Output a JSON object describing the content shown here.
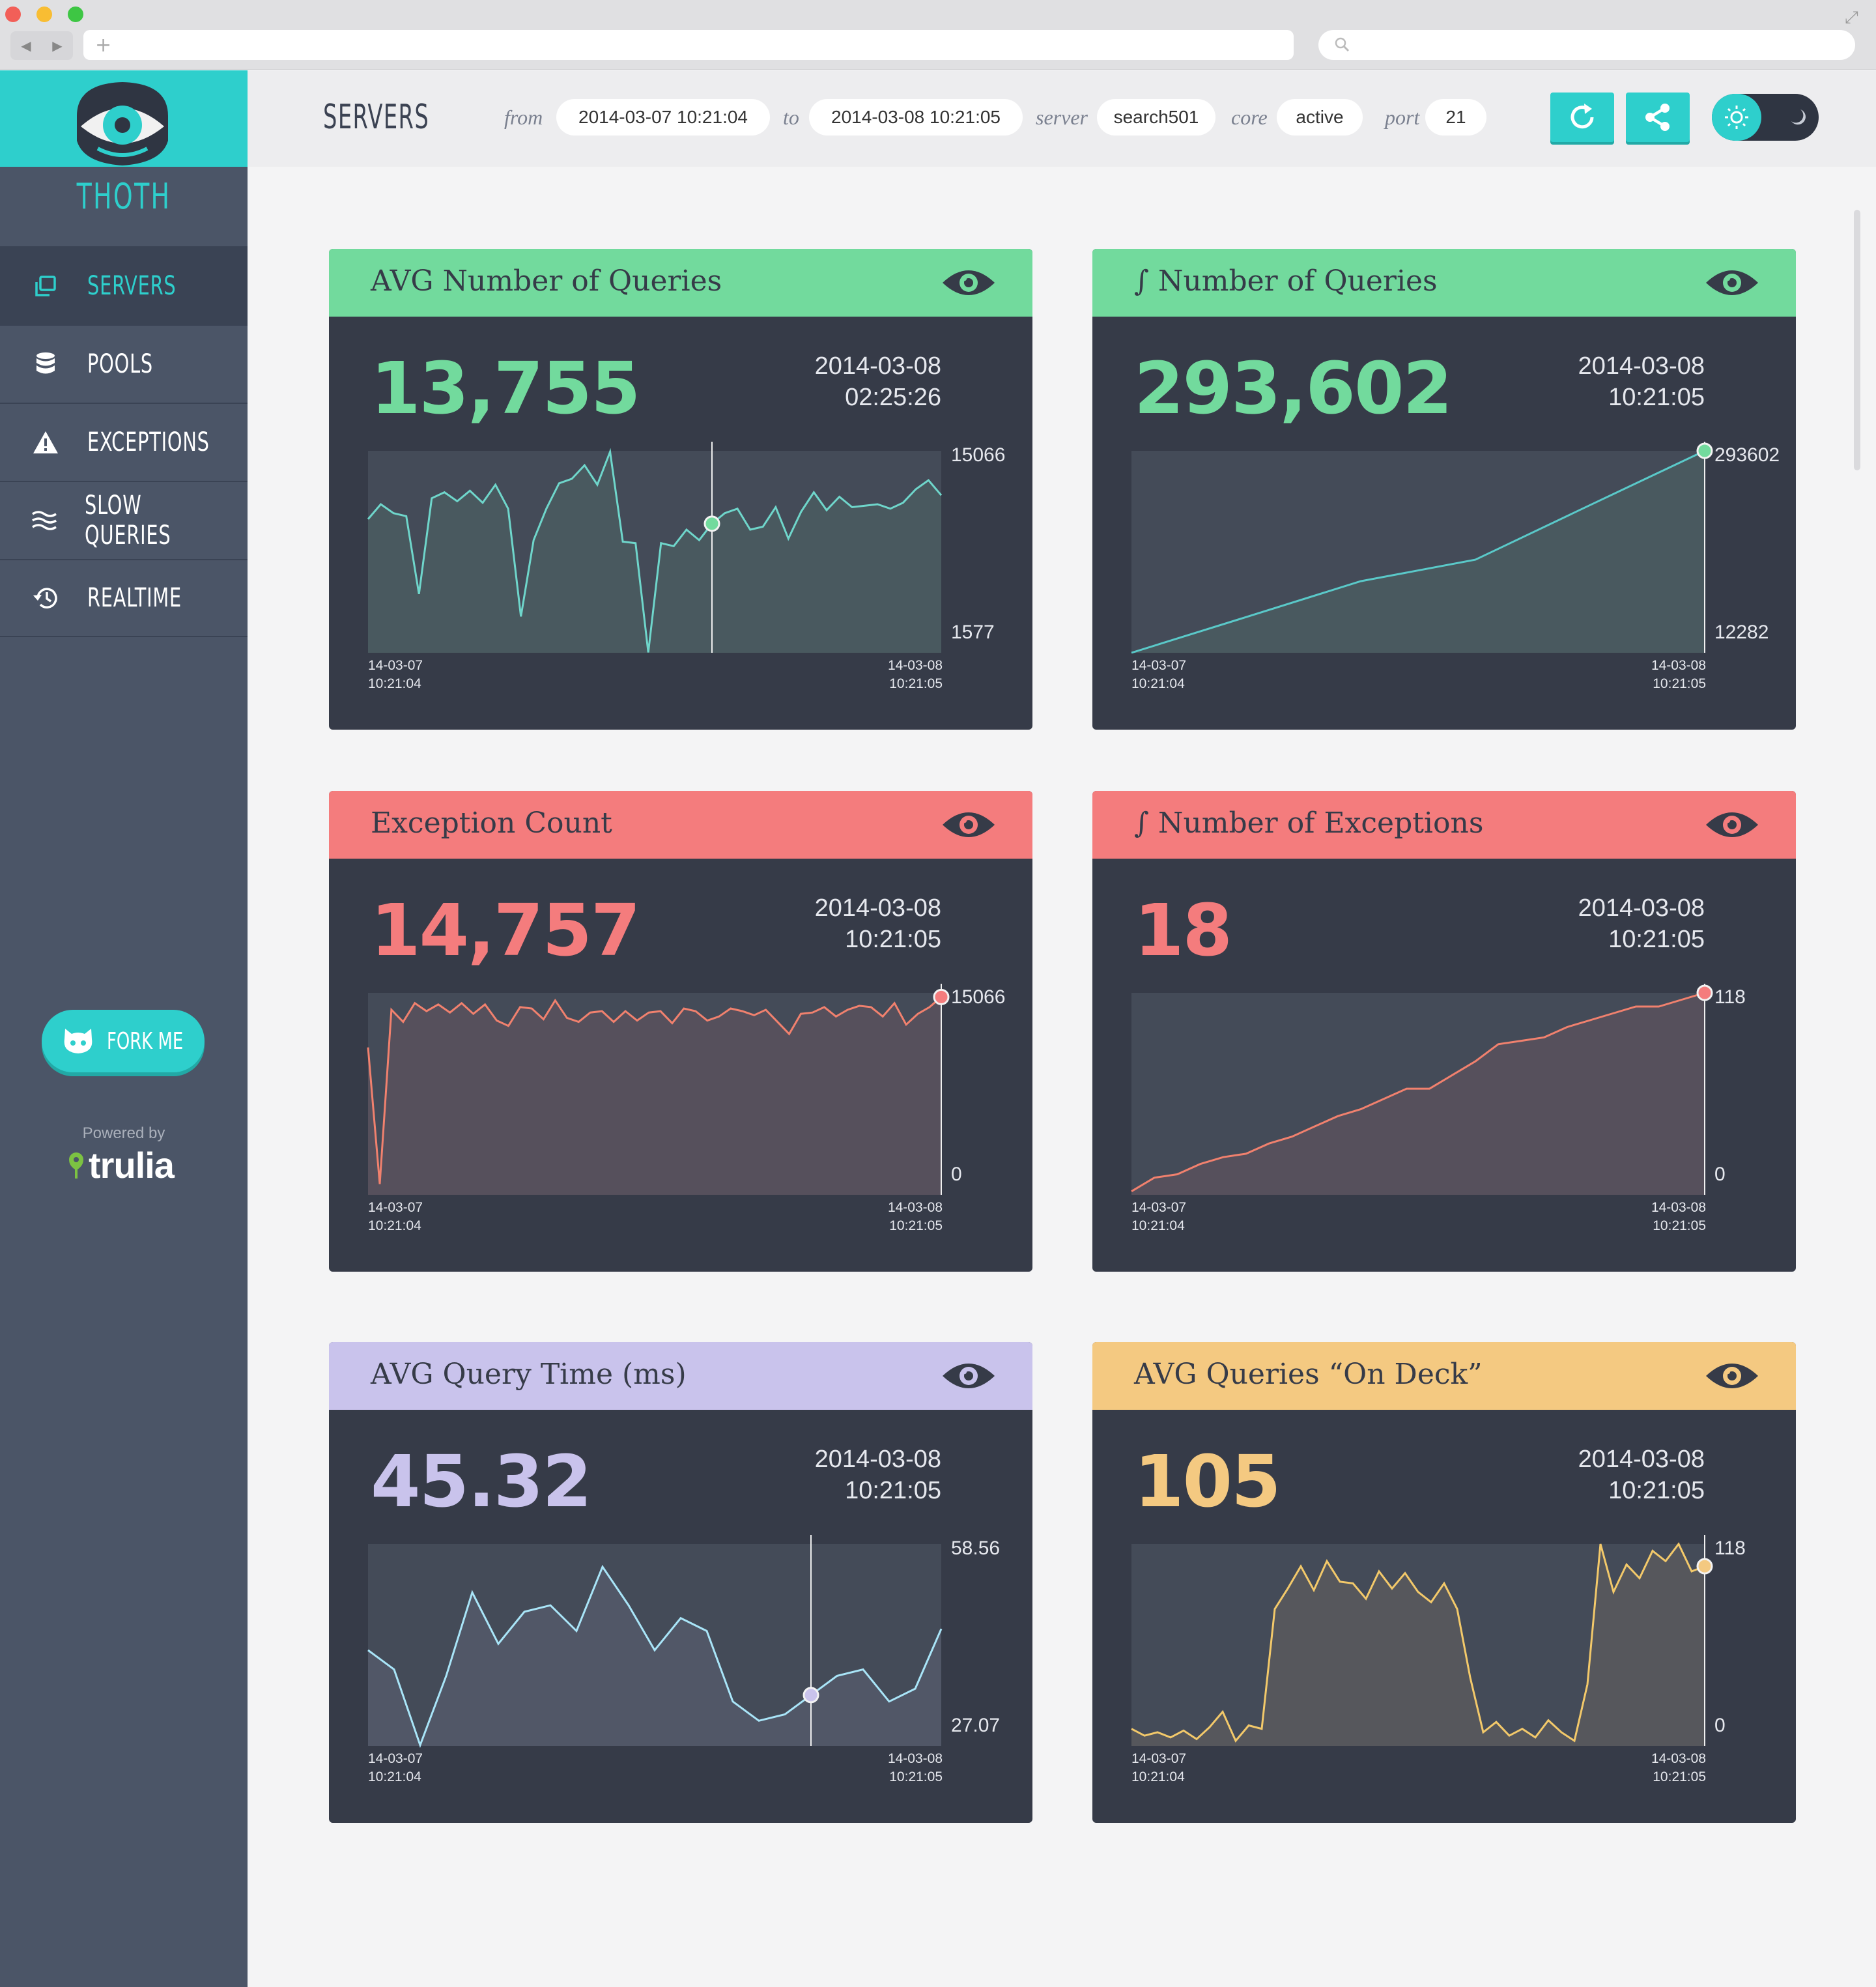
{
  "browser": {
    "new_tab": "+",
    "expand_icon": "expand-icon",
    "search_icon": "search-icon"
  },
  "sidebar": {
    "brand": "THOTH",
    "nav": [
      {
        "label": "SERVERS",
        "icon": "servers-icon",
        "active": true
      },
      {
        "label": "POOLS",
        "icon": "database-icon",
        "active": false
      },
      {
        "label": "EXCEPTIONS",
        "icon": "warning-icon",
        "active": false
      },
      {
        "label": "SLOW QUERIES",
        "icon": "waves-icon",
        "active": false
      },
      {
        "label": "REALTIME",
        "icon": "history-icon",
        "active": false
      }
    ],
    "fork_label": "FORK ME",
    "powered_by": "Powered by",
    "trulia": "trulia"
  },
  "topbar": {
    "title": "SERVERS",
    "from_label": "from",
    "from_value": "2014-03-07 10:21:04",
    "to_label": "to",
    "to_value": "2014-03-08 10:21:05",
    "server_label": "server",
    "server_value": "search501",
    "core_label": "core",
    "core_value": "active",
    "port_label": "port",
    "port_value": "21"
  },
  "colors": {
    "accent": "#2ecfcc",
    "green": "#72da9d",
    "red": "#f47c7d",
    "purple": "#c9c3ec",
    "yellow": "#f4c981",
    "card_bg": "#363b48",
    "sidebar": "#4b5567"
  },
  "cards": [
    {
      "title": "AVG Number of Queries",
      "value": "13,755",
      "date": "2014-03-08",
      "time": "02:25:26",
      "max": "15066",
      "min": "1577",
      "x_start_date": "14-03-07",
      "x_start_time": "10:21:04",
      "x_end_date": "14-03-08",
      "x_end_time": "10:21:05"
    },
    {
      "title": "∫ Number of Queries",
      "value": "293,602",
      "date": "2014-03-08",
      "time": "10:21:05",
      "max": "293602",
      "min": "12282",
      "x_start_date": "14-03-07",
      "x_start_time": "10:21:04",
      "x_end_date": "14-03-08",
      "x_end_time": "10:21:05"
    },
    {
      "title": "Exception Count",
      "value": "14,757",
      "date": "2014-03-08",
      "time": "10:21:05",
      "max": "15066",
      "min": "0",
      "x_start_date": "14-03-07",
      "x_start_time": "10:21:04",
      "x_end_date": "14-03-08",
      "x_end_time": "10:21:05"
    },
    {
      "title": "∫ Number of Exceptions",
      "value": "18",
      "date": "2014-03-08",
      "time": "10:21:05",
      "max": "118",
      "min": "0",
      "x_start_date": "14-03-07",
      "x_start_time": "10:21:04",
      "x_end_date": "14-03-08",
      "x_end_time": "10:21:05"
    },
    {
      "title": "AVG Query Time (ms)",
      "value": "45.32",
      "date": "2014-03-08",
      "time": "10:21:05",
      "max": "58.56",
      "min": "27.07",
      "x_start_date": "14-03-07",
      "x_start_time": "10:21:04",
      "x_end_date": "14-03-08",
      "x_end_time": "10:21:05"
    },
    {
      "title": "AVG Queries “On Deck”",
      "value": "105",
      "date": "2014-03-08",
      "time": "10:21:05",
      "max": "118",
      "min": "0",
      "x_start_date": "14-03-07",
      "x_start_time": "10:21:04",
      "x_end_date": "14-03-08",
      "x_end_time": "10:21:05"
    }
  ],
  "chart_data": [
    {
      "type": "line",
      "ylim": [
        1577,
        15066
      ],
      "color": "#72da9d",
      "line": "#6fd6cb",
      "marker_index": 27,
      "values": [
        10500,
        11500,
        10900,
        10700,
        5500,
        11900,
        12300,
        11700,
        12400,
        11600,
        12800,
        11200,
        4000,
        9100,
        11200,
        12900,
        13200,
        14100,
        12800,
        15000,
        9000,
        8900,
        1600,
        8900,
        8700,
        9800,
        9100,
        10200,
        10900,
        11200,
        9800,
        10000,
        11300,
        9200,
        11000,
        12300,
        11100,
        12000,
        11300,
        11400,
        11500,
        11200,
        11600,
        12500,
        13100,
        12100
      ]
    },
    {
      "type": "area",
      "ylim": [
        12282,
        293602
      ],
      "color": "#72da9d",
      "line": "#5ac9c9",
      "marker_index": 5,
      "values": [
        12282,
        62000,
        112000,
        142000,
        218000,
        293602
      ]
    },
    {
      "type": "line",
      "ylim": [
        0,
        15066
      ],
      "color": "#f47c7d",
      "line": "#f1816e",
      "marker_index": 49,
      "values": [
        11000,
        800,
        13800,
        12900,
        14300,
        13700,
        14200,
        13600,
        14300,
        13500,
        14200,
        13000,
        12600,
        14000,
        13900,
        13100,
        14500,
        13200,
        12900,
        13600,
        13700,
        12900,
        13700,
        13000,
        13600,
        13700,
        12800,
        13900,
        13700,
        13000,
        13300,
        13900,
        13700,
        13400,
        13800,
        12900,
        12000,
        13500,
        13600,
        14000,
        13300,
        13800,
        14100,
        14000,
        13300,
        14300,
        12700,
        13500,
        14000,
        14757
      ]
    },
    {
      "type": "line",
      "ylim": [
        0,
        118
      ],
      "color": "#f47c7d",
      "line": "#f1816e",
      "marker_index": 25,
      "values": [
        2,
        10,
        12,
        18,
        22,
        24,
        30,
        34,
        40,
        46,
        50,
        56,
        62,
        62,
        70,
        78,
        88,
        90,
        92,
        98,
        102,
        106,
        110,
        110,
        114,
        118
      ]
    },
    {
      "type": "line",
      "ylim": [
        27.07,
        58.56
      ],
      "color": "#c9c3ec",
      "line": "#a9e5f8",
      "marker_index": 17,
      "values": [
        42,
        39,
        27.2,
        38,
        51,
        43,
        48,
        49,
        45,
        55,
        49,
        42,
        47,
        45,
        34,
        31,
        32,
        35,
        38,
        39,
        34,
        36,
        45.32
      ]
    },
    {
      "type": "line",
      "ylim": [
        0,
        118
      ],
      "color": "#f4c981",
      "line": "#f3c96a",
      "marker_index": 44,
      "values": [
        10,
        6,
        8,
        5,
        9,
        4,
        11,
        20,
        3,
        12,
        10,
        80,
        92,
        105,
        91,
        108,
        96,
        95,
        86,
        102,
        92,
        101,
        90,
        84,
        95,
        80,
        40,
        8,
        14,
        6,
        10,
        5,
        15,
        8,
        3,
        36,
        118,
        90,
        106,
        98,
        114,
        108,
        118,
        102,
        105
      ]
    }
  ]
}
